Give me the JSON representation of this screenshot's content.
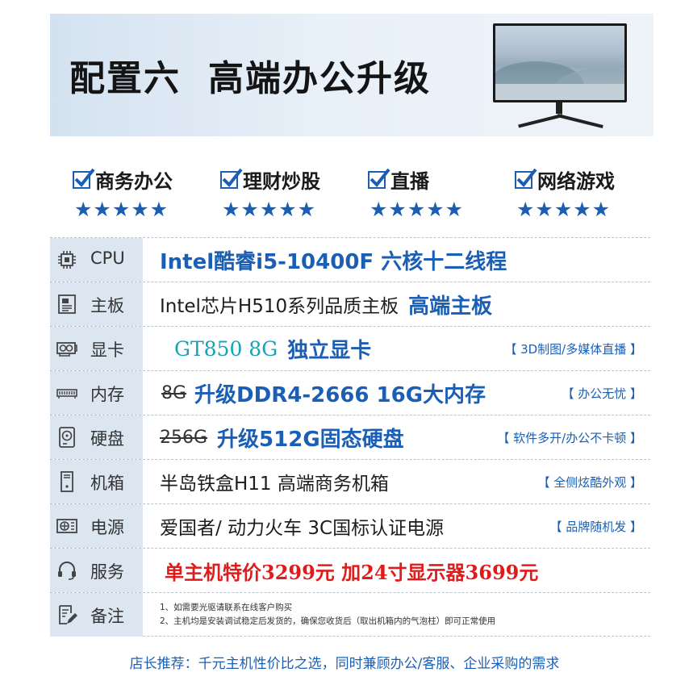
{
  "header": {
    "title_part1": "配置六",
    "title_part2": "高端办公升级"
  },
  "features": [
    {
      "label": "商务办公",
      "stars": "★★★★★"
    },
    {
      "label": "理财炒股",
      "stars": "★★★★★"
    },
    {
      "label": "直播",
      "stars": "★★★★★"
    },
    {
      "label": "网络游戏",
      "stars": "★★★★★"
    }
  ],
  "specs": {
    "cpu": {
      "name": "CPU",
      "value": "Intel酷睿i5-10400F  六核十二线程"
    },
    "board": {
      "name": "主板",
      "value": "Intel芯片H510系列品质主板",
      "highlight": "高端主板"
    },
    "gpu": {
      "name": "显卡",
      "value": "GT850 8G",
      "highlight": "独立显卡",
      "tag": "【 3D制图/多媒体直播 】"
    },
    "ram": {
      "name": "内存",
      "old": "8G",
      "value": "升级DDR4-2666  16G大内存",
      "tag": "【 办公无忧 】"
    },
    "disk": {
      "name": "硬盘",
      "old": "256G",
      "value": "升级512G固态硬盘",
      "tag": "【 软件多开/办公不卡顿 】"
    },
    "case": {
      "name": "机箱",
      "value": "半岛铁盒H11 高端商务机箱",
      "tag": "【 全侧炫酷外观 】"
    },
    "psu": {
      "name": "电源",
      "value": "爱国者/ 动力火车  3C国标认证电源",
      "tag": "【 品牌随机发 】"
    },
    "service": {
      "name": "服务",
      "value": "单主机特价3299元  加24寸显示器3699元"
    },
    "notes": {
      "name": "备注",
      "line1": "1、如需要光驱请联系在线客户购买",
      "line2": "2、主机均是安装调试稳定后发货的，确保您收货后（取出机箱内的气泡柱）即可正常使用"
    }
  },
  "footer": {
    "text": "店长推荐：千元主机性价比之选，同时兼顾办公/客服、企业采购的需求"
  },
  "colors": {
    "accent_blue": "#1b5fb5",
    "price_red": "#e01b1b",
    "gpu_teal": "#16a2b8",
    "category_bg": "#dbe6f1"
  }
}
